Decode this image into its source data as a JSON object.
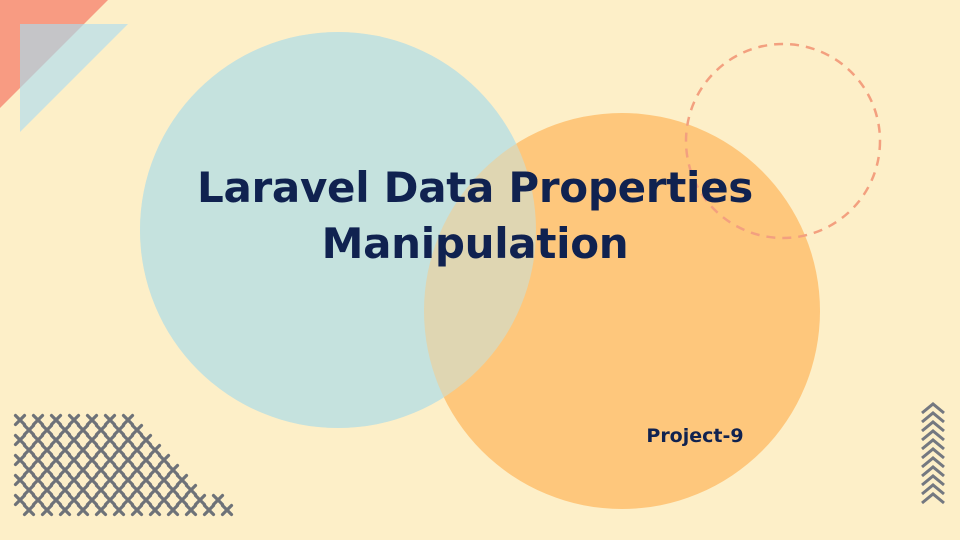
{
  "slide": {
    "title_line_1": "Laravel Data Properties",
    "title_line_2": "Manipulation",
    "subtitle": "Project-9"
  },
  "colors": {
    "background": "#fdefc8",
    "title_text": "#102250",
    "teal_circle": "#c5e2de",
    "orange_circle": "#fec77c",
    "dashed_circle": "#f3a07f",
    "coral_triangle": "#f89b82",
    "gray_triangle": "#c5c5c8",
    "light_blue_triangle": "#cae3e2",
    "cross_marks": "#6e7278",
    "chevrons": "#747880"
  },
  "decorations": {
    "corner_triangles": "corner-triangles",
    "cross_pattern_icon": "cross-pattern-icon",
    "chevron_stack_icon": "chevron-stack-icon"
  }
}
